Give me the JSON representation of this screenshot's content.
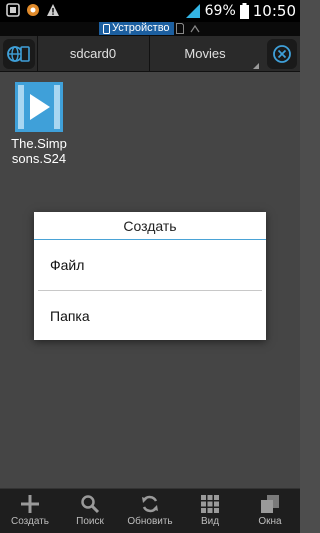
{
  "status_bar": {
    "battery_percent": "69%",
    "time": "10:50"
  },
  "device_bar": {
    "label": "Устройство"
  },
  "path_bar": {
    "crumbs": [
      "sdcard0",
      "Movies"
    ]
  },
  "files": [
    {
      "name": "The.Simpsons.S24",
      "icon": "video-file-icon"
    }
  ],
  "dialog": {
    "title": "Создать",
    "items": [
      "Файл",
      "Папка"
    ]
  },
  "bottom_bar": {
    "items": [
      {
        "label": "Создать",
        "icon": "plus-icon"
      },
      {
        "label": "Поиск",
        "icon": "search-icon"
      },
      {
        "label": "Обновить",
        "icon": "refresh-icon"
      },
      {
        "label": "Вид",
        "icon": "grid-icon"
      },
      {
        "label": "Окна",
        "icon": "windows-icon"
      }
    ]
  },
  "colors": {
    "accent": "#1c5fa0",
    "dialog_divider": "#4aa3d6",
    "file_icon": "#3fa0d9"
  }
}
